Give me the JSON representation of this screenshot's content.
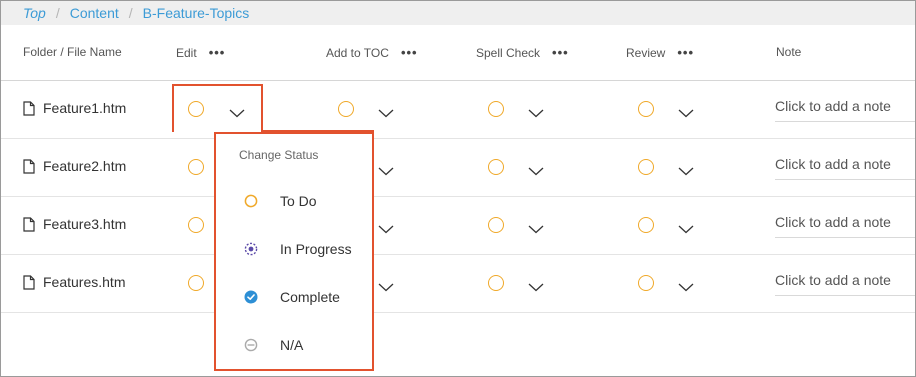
{
  "breadcrumb": {
    "items": [
      "Top",
      "Content",
      "B-Feature-Topics"
    ],
    "separator": "/"
  },
  "columns": {
    "name": "Folder / File Name",
    "edit": "Edit",
    "toc": "Add to TOC",
    "spell": "Spell Check",
    "review": "Review",
    "note": "Note",
    "menu_glyph": "•••"
  },
  "rows": [
    {
      "file": "Feature1.htm",
      "note": "Click to add a note"
    },
    {
      "file": "Feature2.htm",
      "note": "Click to add a note"
    },
    {
      "file": "Feature3.htm",
      "note": "Click to add a note"
    },
    {
      "file": "Features.htm",
      "note": "Click to add a note"
    }
  ],
  "status_menu": {
    "title": "Change Status",
    "options": [
      {
        "label": "To Do",
        "icon": "todo-circle-icon"
      },
      {
        "label": "In Progress",
        "icon": "in-progress-icon"
      },
      {
        "label": "Complete",
        "icon": "complete-check-icon"
      },
      {
        "label": "N/A",
        "icon": "na-icon"
      }
    ]
  },
  "colors": {
    "accent": "#3c9bd6",
    "status_todo": "#f0a92a",
    "highlight": "#e2522e",
    "progress": "#5b4aa8",
    "complete": "#2d8fd5",
    "na": "#aaaaaa"
  }
}
